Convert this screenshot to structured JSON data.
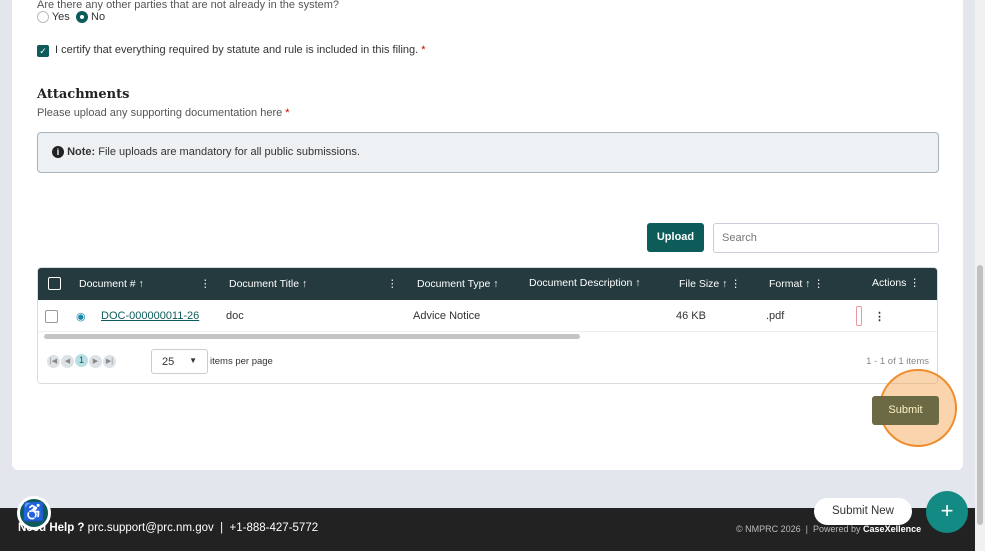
{
  "question": {
    "label": "Are there any other parties that are not already in the system?",
    "options": [
      "Yes",
      "No"
    ],
    "selected": "No"
  },
  "certify": {
    "label": "I certify that everything required by statute and rule is included in this filing.",
    "checked": true
  },
  "attachments": {
    "title": "Attachments",
    "subtitle": "Please upload any supporting documentation here",
    "required": "*",
    "note_label": "Note:",
    "note_text": "File uploads are mandatory for all public submissions.",
    "upload_label": "Upload",
    "search_placeholder": "Search"
  },
  "grid": {
    "columns": [
      "Document #",
      "Document Title",
      "Document Type",
      "Document Description",
      "File Size",
      "Format",
      "Actions"
    ],
    "rows": [
      {
        "doc": "DOC-000000011-26",
        "title": "doc",
        "type": "Advice Notice",
        "description": "",
        "size": "46 KB",
        "format": ".pdf"
      }
    ],
    "page": "1",
    "page_size": "25",
    "per_page_label": "items per page",
    "summary": "1 - 1 of 1 items"
  },
  "submit_label": "Submit",
  "fab": {
    "tooltip": "Submit New",
    "icon": "plus-icon"
  },
  "footer": {
    "help": "Need Help ?",
    "email": "prc.support@prc.nm.gov",
    "sep": "|",
    "phone": "+1-888-427-5772",
    "copyright": "© NMPRC 2026",
    "powered": "Powered by",
    "brand": "CaseXellence"
  },
  "colors": {
    "primary": "#0d5c5a",
    "header": "#253a3e",
    "footer": "#222222",
    "highlight": "#f5a04a"
  }
}
